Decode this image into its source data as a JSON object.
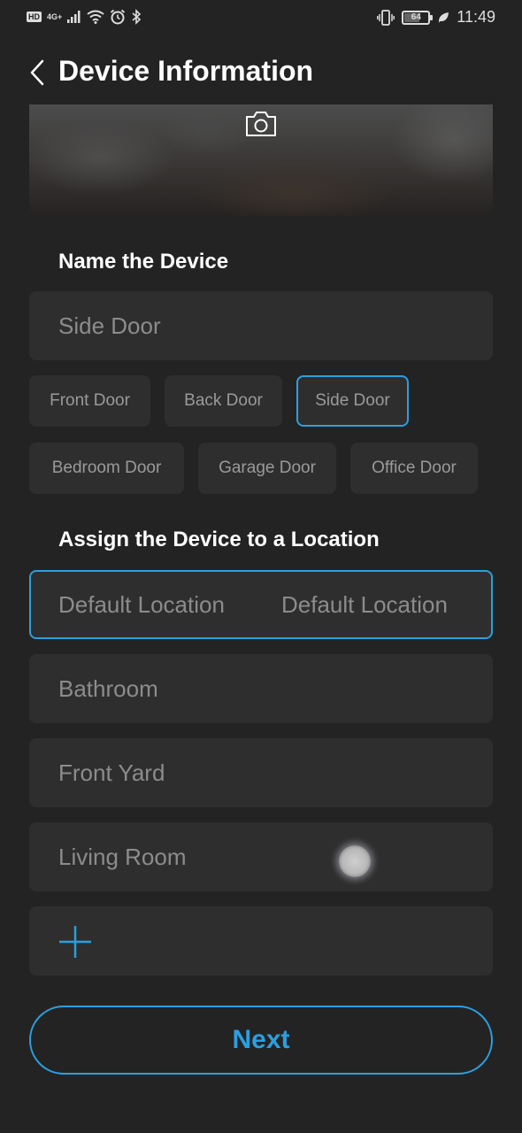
{
  "status_bar": {
    "hd": "HD",
    "network": "4G+",
    "battery": "64",
    "battery_level_percent": 64,
    "time": "11:49",
    "icons": [
      "signal-icon",
      "wifi-icon",
      "alarm-icon",
      "bluetooth-icon",
      "vibrate-icon",
      "battery-icon",
      "leaf-icon"
    ]
  },
  "header": {
    "title": "Device Information",
    "back_icon": "chevron-left-icon"
  },
  "photo": {
    "camera_icon": "camera-icon"
  },
  "name_section": {
    "title": "Name the Device",
    "input_value": "Side Door",
    "suggestions": [
      {
        "label": "Front Door",
        "selected": false
      },
      {
        "label": "Back Door",
        "selected": false
      },
      {
        "label": "Side Door",
        "selected": true
      },
      {
        "label": "Bedroom Door",
        "selected": false
      },
      {
        "label": "Garage Door",
        "selected": false
      },
      {
        "label": "Office Door",
        "selected": false
      }
    ]
  },
  "location_section": {
    "title": "Assign the Device to a Location",
    "locations": [
      {
        "label": "Default Location",
        "secondary": "Default Location",
        "selected": true
      },
      {
        "label": "Bathroom",
        "selected": false
      },
      {
        "label": "Front Yard",
        "selected": false
      },
      {
        "label": "Living Room",
        "selected": false
      }
    ],
    "add_icon": "plus-icon"
  },
  "footer": {
    "next_label": "Next"
  },
  "colors": {
    "background": "#232323",
    "card": "#2e2e2e",
    "accent": "#2b9fe0",
    "muted_text": "#8c8c8c"
  }
}
